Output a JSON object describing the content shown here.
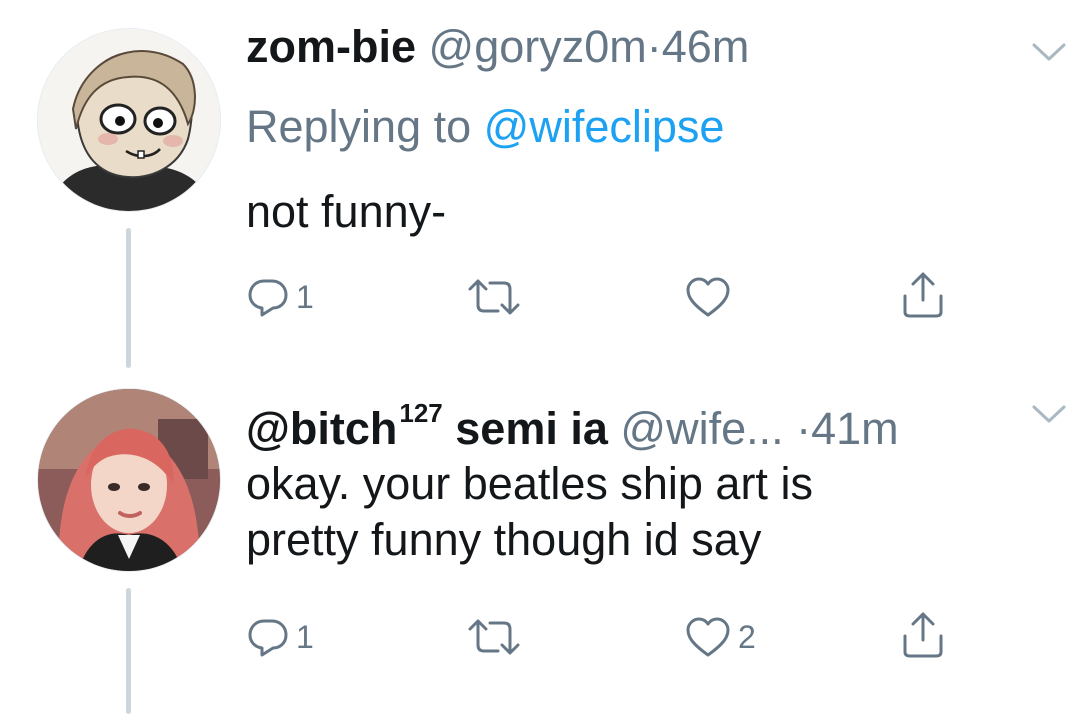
{
  "tweets": [
    {
      "display_name": "zom-bie",
      "display_name_sup": "",
      "display_name_suffix": "",
      "handle": "@goryz0m",
      "separator": "·",
      "time": "46m",
      "replying_prefix": "Replying to",
      "replying_to": "@wifeclipse",
      "text": "not funny-",
      "actions": {
        "reply_count": "1",
        "retweet_count": "",
        "like_count": ""
      }
    },
    {
      "display_name": "@bitch",
      "display_name_sup": "127",
      "display_name_suffix": " semi ia",
      "handle": "@wife...",
      "separator": "·",
      "time": "41m",
      "text": "okay. your beatles ship art is\npretty funny though id say",
      "actions": {
        "reply_count": "1",
        "retweet_count": "",
        "like_count": "2"
      }
    }
  ],
  "icons": {
    "reply": "reply-icon",
    "retweet": "retweet-icon",
    "like": "heart-icon",
    "share": "share-icon",
    "more": "chevron-down-icon"
  },
  "colors": {
    "secondary_text": "#657786",
    "link": "#1da1f2",
    "thread_line": "#ccd6dd"
  }
}
